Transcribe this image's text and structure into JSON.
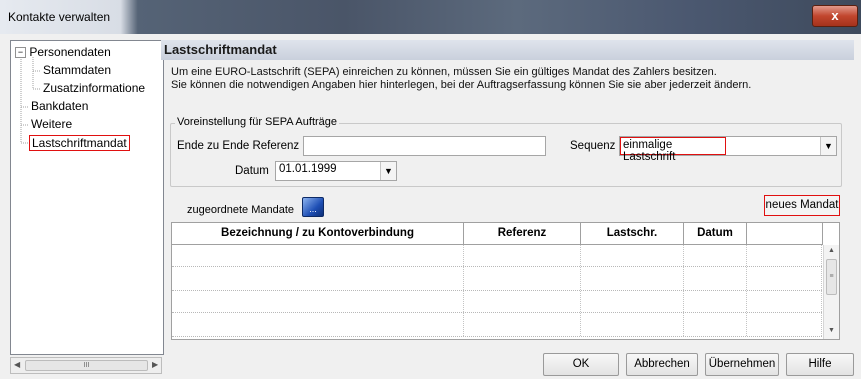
{
  "window": {
    "title": "Kontakte verwalten",
    "close_label": "x"
  },
  "tree": {
    "items": [
      {
        "label": "Personendaten",
        "expander": "⊟"
      },
      {
        "label": "Stammdaten"
      },
      {
        "label": "Zusatzinformatione"
      },
      {
        "label": "Bankdaten"
      },
      {
        "label": "Weitere"
      },
      {
        "label": "Lastschriftmandat"
      }
    ],
    "scroll_thumb_grip": "III"
  },
  "panel": {
    "title": "Lastschriftmandat",
    "desc_line1": "Um eine EURO-Lastschrift (SEPA) einreichen zu können, müssen Sie ein gültiges Mandat des Zahlers besitzen.",
    "desc_line2": "Sie können die notwendigen Angaben  hier hinterlegen, bei der Auftragserfassung können Sie sie aber jederzeit ändern."
  },
  "sepa": {
    "group_label": "Voreinstellung für SEPA Aufträge",
    "ref_label": "Ende zu Ende Referenz",
    "ref_value": "",
    "seq_label": "Sequenz",
    "seq_value": "einmalige Lastschrift",
    "datum_label": "Datum",
    "datum_value": "01.01.1999"
  },
  "mandates": {
    "label": "zugeordnete Mandate",
    "icon_label": "...",
    "new_button": "neues Mandat",
    "columns": [
      "Bezeichnung / zu Kontoverbindung",
      "Referenz",
      "Lastschr.",
      "Datum",
      ""
    ],
    "rows": [
      [
        "",
        "",
        "",
        "",
        ""
      ],
      [
        "",
        "",
        "",
        "",
        ""
      ],
      [
        "",
        "",
        "",
        "",
        ""
      ],
      [
        "",
        "",
        "",
        "",
        ""
      ],
      [
        "",
        "",
        "",
        "",
        ""
      ]
    ]
  },
  "buttons": {
    "ok": "OK",
    "cancel": "Abbrechen",
    "apply": "Übernehmen",
    "help": "Hilfe"
  }
}
